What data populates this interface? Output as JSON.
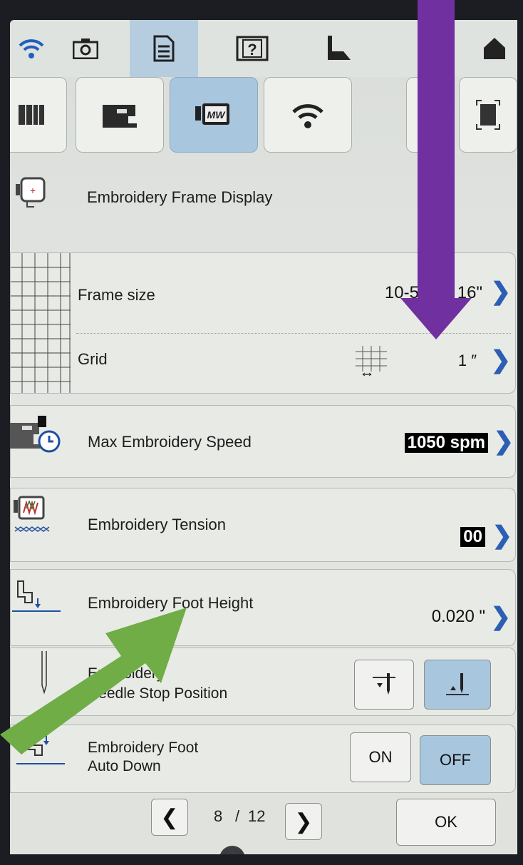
{
  "toolbar": {
    "icons": [
      "wifi-icon",
      "camera-icon",
      "document-icon",
      "help-icon",
      "presser-foot-icon",
      "lock-icon",
      "home-icon"
    ]
  },
  "tabs": {
    "icons": [
      "embroidery-hoop-pattern-icon",
      "sewing-machine-icon",
      "embroidery-frame-icon",
      "wifi-icon",
      "arrow-tab-icon",
      "fit-screen-icon"
    ]
  },
  "rows": {
    "frame_display_label": "Embroidery Frame Display",
    "frame_size_label": "Frame size",
    "frame_size_value": "10-5/8\" x 16\"",
    "grid_label": "Grid",
    "grid_value": "1 ″",
    "max_speed_label": "Max Embroidery Speed",
    "max_speed_value": "1050 spm",
    "tension_label": "Embroidery Tension",
    "tension_value": "00",
    "foot_height_label": "Embroidery Foot Height",
    "foot_height_value": "0.020 \"",
    "needle_stop_label_1": "Embroidery",
    "needle_stop_label_2": "Needle Stop Position",
    "auto_down_label_1": "Embroidery Foot",
    "auto_down_label_2": "Auto Down",
    "on_label": "ON",
    "off_label": "OFF"
  },
  "pager": {
    "current": "8",
    "separator": "/",
    "total": "12",
    "ok_label": "OK"
  },
  "colors": {
    "accent_blue": "#2c5fb3",
    "selected_tab": "#a9c6df",
    "arrow_purple": "#7030a0",
    "arrow_green": "#70ad47"
  }
}
